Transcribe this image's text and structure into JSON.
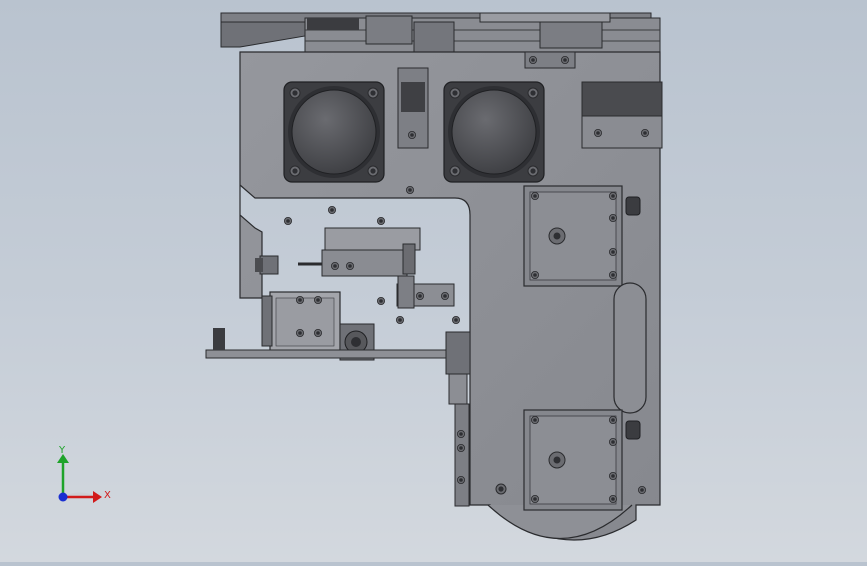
{
  "viewport": {
    "background_top": "#b9c3cf",
    "background_bottom": "#d3d8de"
  },
  "model": {
    "body_color": "#8d8f95",
    "dark_color": "#4b4c50",
    "edge_color": "#2a2b2e",
    "motor_face_color": "#58595d"
  },
  "triad": {
    "x_label": "X",
    "y_label": "Y",
    "x_color": "#d11a1a",
    "y_color": "#1ea32a",
    "z_color": "#1a2fd1",
    "icon": "coordinate-triad-icon"
  }
}
